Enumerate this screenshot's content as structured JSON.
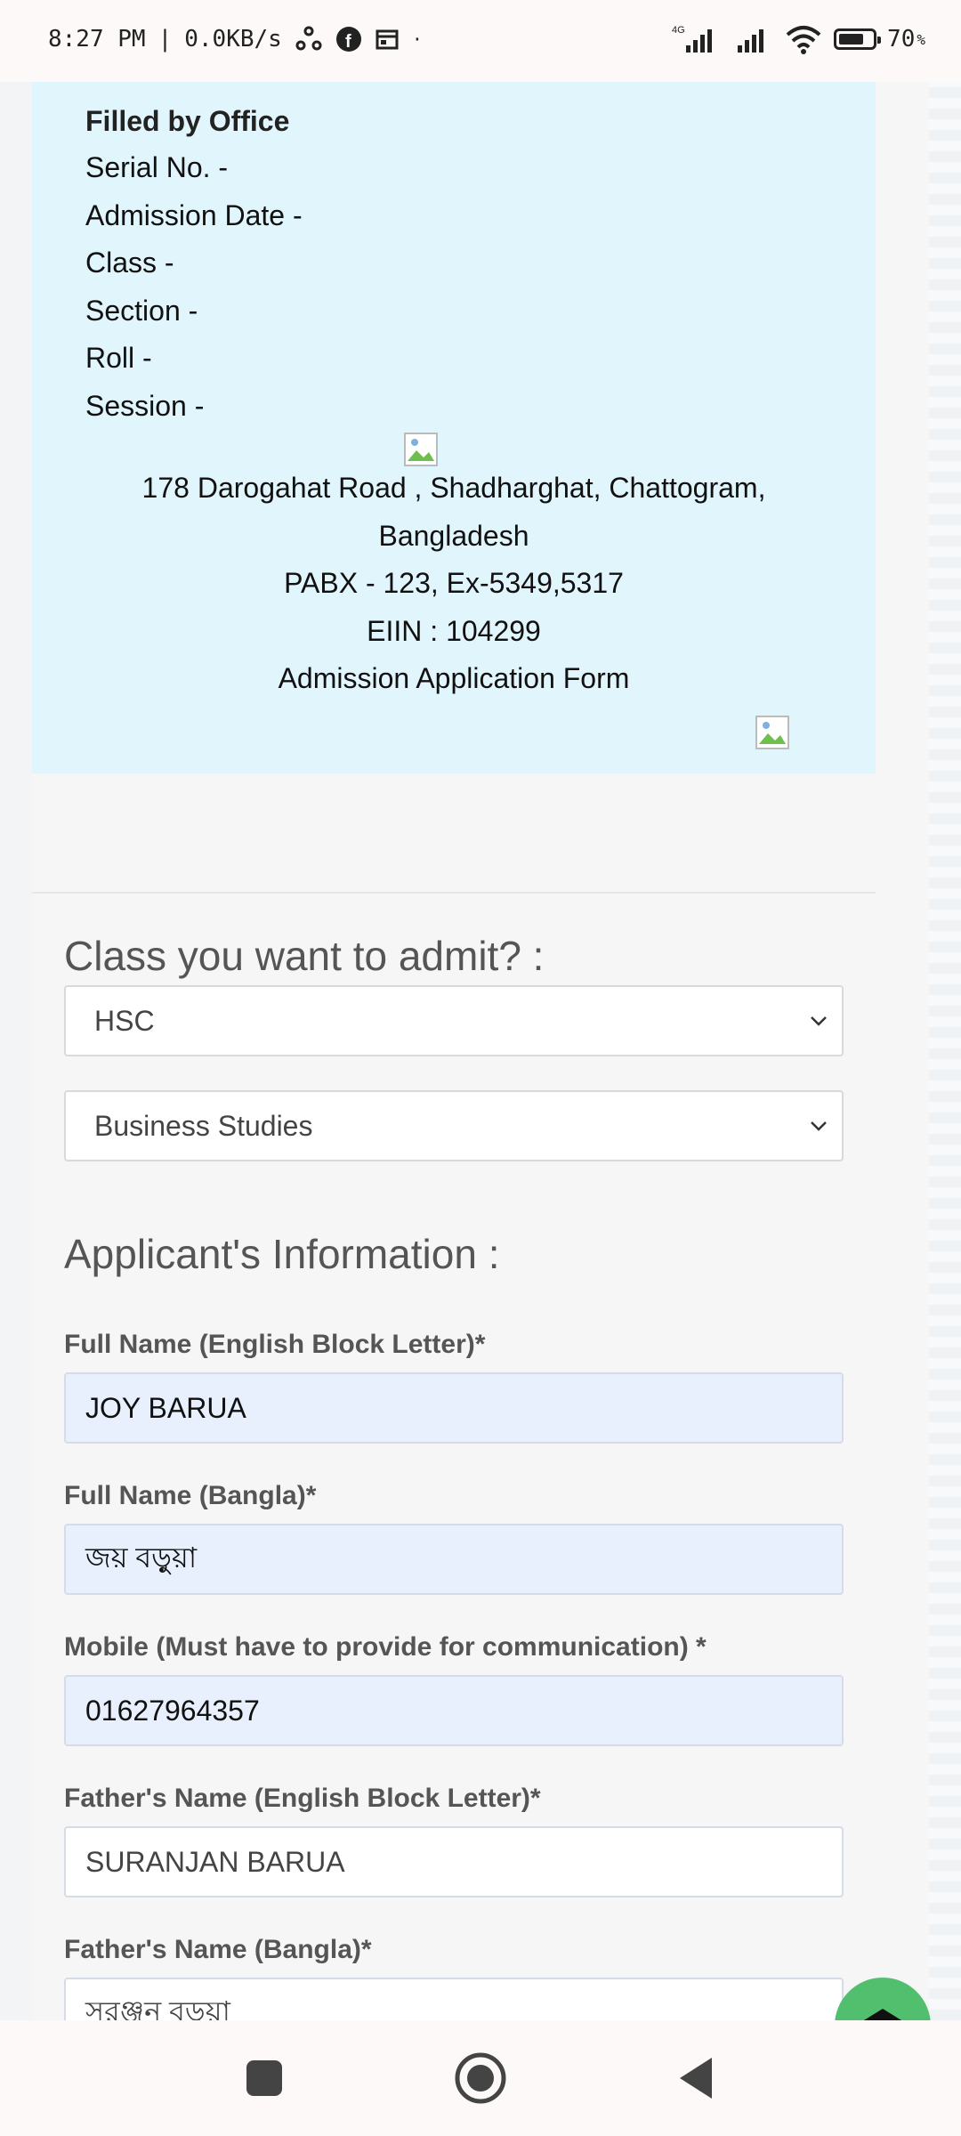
{
  "status_bar": {
    "time": "8:27 PM",
    "speed": "0.0KB/s",
    "battery": "70",
    "network": "4G"
  },
  "office": {
    "title": "Filled by Office",
    "lines": [
      "Serial No. -",
      "Admission Date -",
      "Class -",
      "Section -",
      "Roll -",
      "Session -"
    ],
    "address_1": "178 Darogahat Road , Shadharghat, Chattogram,",
    "address_2": "Bangladesh",
    "pabx": "PABX - 123, Ex-5349,5317",
    "eiin": "EIIN : 104299",
    "form_title": "Admission Application Form"
  },
  "admit": {
    "heading": "Class you want to admit? :",
    "class_select": "HSC",
    "group_select": "Business Studies"
  },
  "applicant": {
    "heading": "Applicant's Information :",
    "fields": [
      {
        "label": "Full Name (English Block Letter)*",
        "value": "JOY BARUA"
      },
      {
        "label": "Full Name (Bangla)*",
        "value": "জয় বড়ুয়া"
      },
      {
        "label": "Mobile (Must have to provide for communication) *",
        "value": "01627964357"
      },
      {
        "label": "Father's Name (English Block Letter)*",
        "value": "SURANJAN BARUA"
      },
      {
        "label": "Father's Name (Bangla)*",
        "value": "সুরঞ্জন বড়ুয়া"
      }
    ]
  },
  "colors": {
    "office_bg": "#e1f5fd",
    "filled_input_bg": "#e8f0fe",
    "back_to_top": "#52bf6f"
  }
}
